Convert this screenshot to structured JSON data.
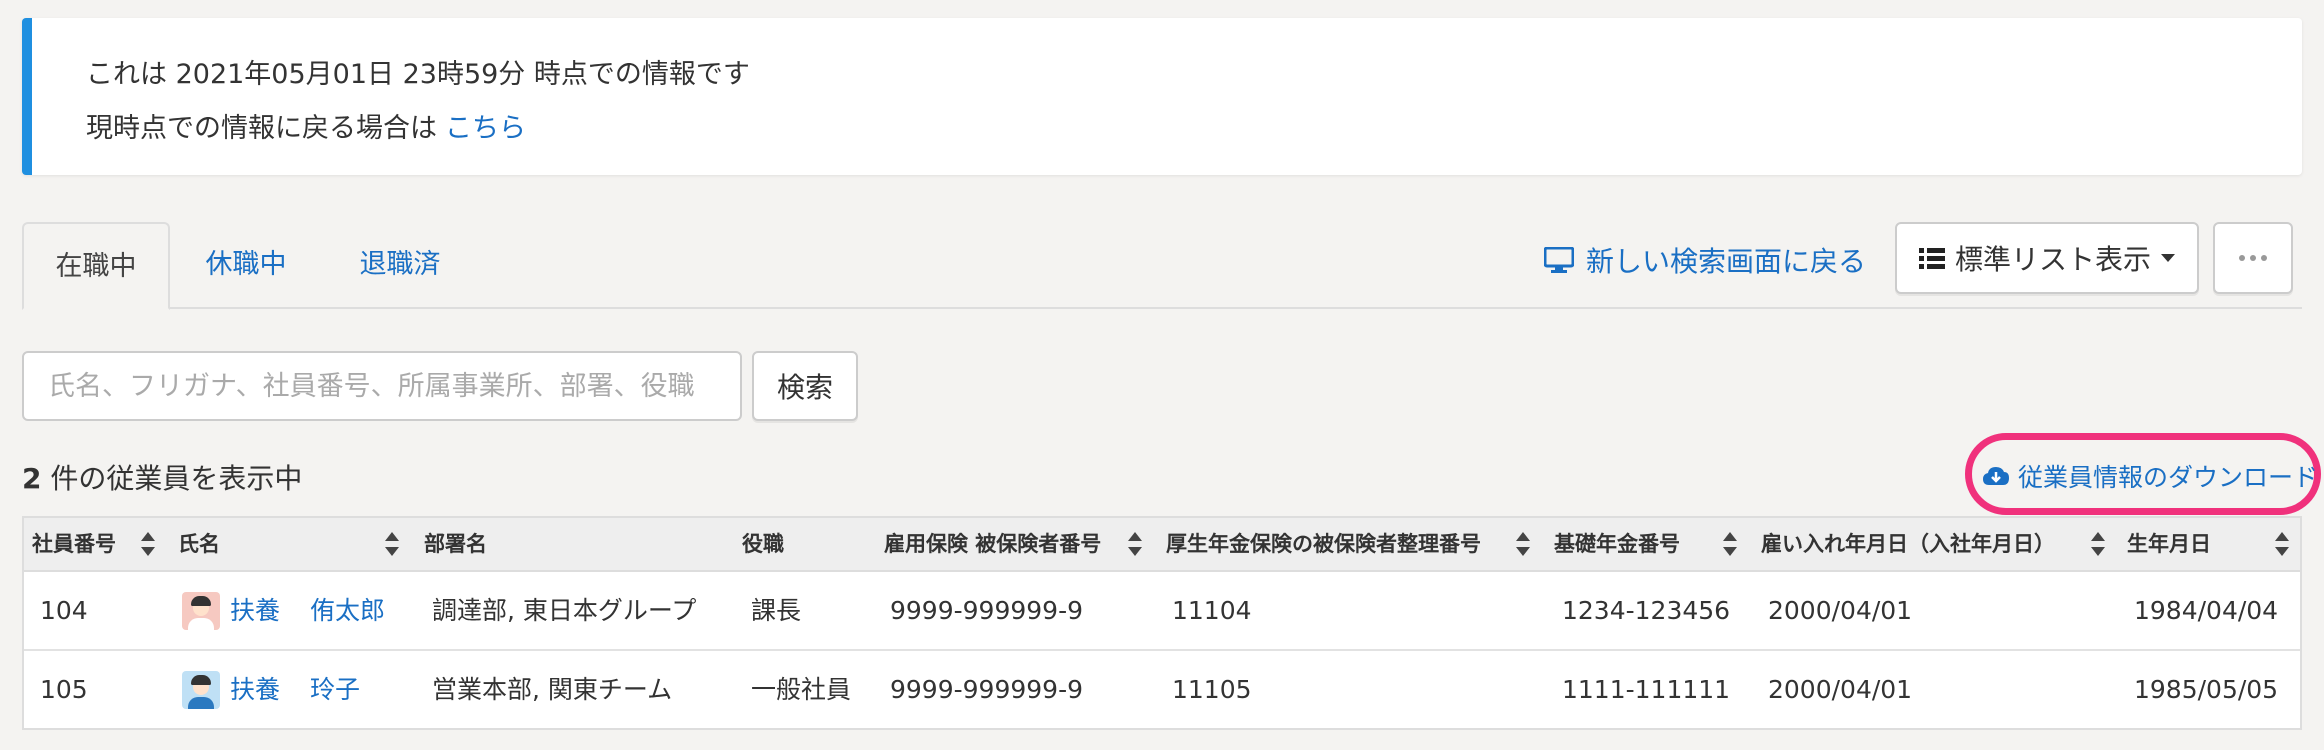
{
  "banner": {
    "line1": "これは 2021年05月01日 23時59分 時点での情報です",
    "line2_prefix": "現時点での情報に戻る場合は",
    "line2_link": "こちら",
    "accent_color": "#1f8fe0"
  },
  "tabs": [
    {
      "label": "在職中",
      "active": true
    },
    {
      "label": "休職中",
      "active": false
    },
    {
      "label": "退職済",
      "active": false
    }
  ],
  "header": {
    "back_link": "新しい検索画面に戻る",
    "back_icon": "monitor-icon",
    "list_button": "標準リスト表示",
    "list_icon": "list-icon",
    "more_icon": "ellipsis-icon"
  },
  "search": {
    "placeholder": "氏名、フリガナ、社員番号、所属事業所、部署、役職",
    "value": "",
    "button": "検索"
  },
  "results": {
    "count": "2",
    "count_suffix": "件の従業員を表示中",
    "download": "従業員情報のダウンロード",
    "download_icon": "cloud-download-icon",
    "highlight_color": "#f0317c"
  },
  "table": {
    "columns": [
      "社員番号",
      "氏名",
      "部署名",
      "役職",
      "雇用保険 被保険者番号",
      "厚生年金保険の被保険者整理番号",
      "基礎年金番号",
      "雇い入れ年月日（入社年月日）",
      "生年月日"
    ],
    "rows": [
      {
        "id": "104",
        "family_name": "扶養",
        "given_name": "侑太郎",
        "avatar": "male-avatar-icon",
        "department": "調達部, 東日本グループ",
        "position": "課長",
        "employment_insurance": "9999-999999-9",
        "pension_number": "11104",
        "basic_pension": "1234-123456",
        "hire_date": "2000/04/01",
        "birth_date": "1984/04/04"
      },
      {
        "id": "105",
        "family_name": "扶養",
        "given_name": "玲子",
        "avatar": "female-avatar-icon",
        "department": "営業本部, 関東チーム",
        "position": "一般社員",
        "employment_insurance": "9999-999999-9",
        "pension_number": "11105",
        "basic_pension": "1111-111111",
        "hire_date": "2000/04/01",
        "birth_date": "1985/05/05"
      }
    ]
  },
  "link_color": "#1a6fc4"
}
